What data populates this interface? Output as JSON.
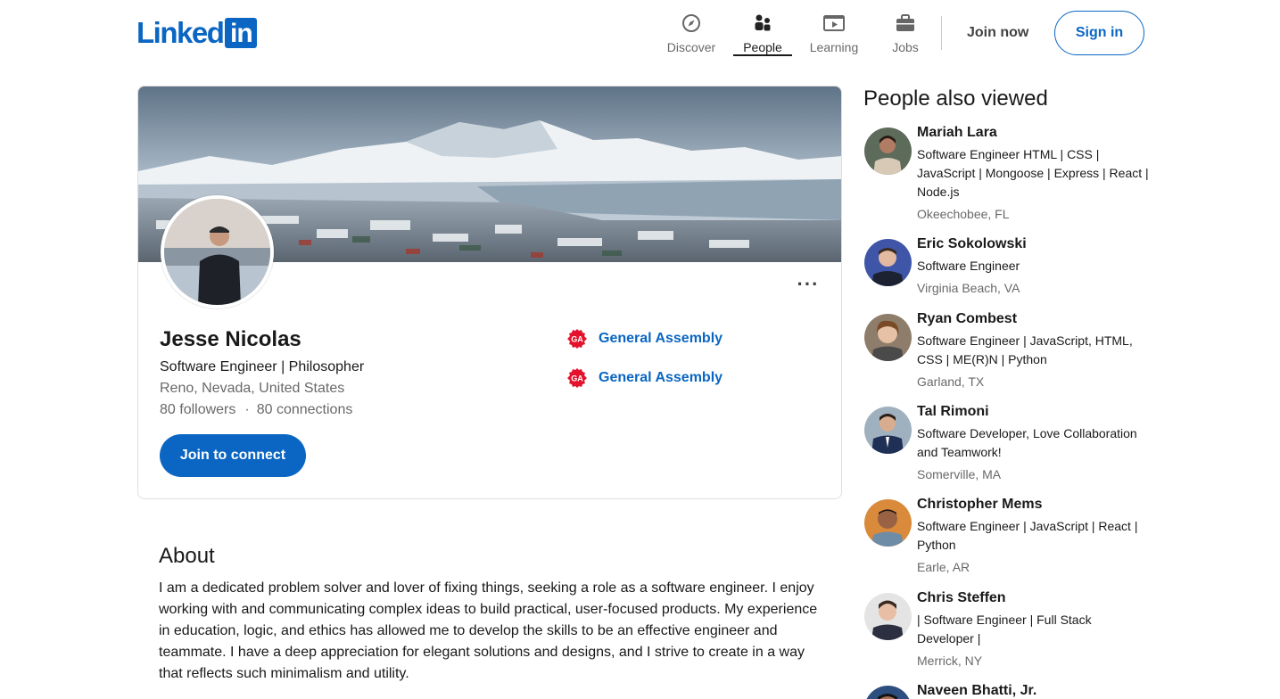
{
  "header": {
    "logo_word": "Linked",
    "logo_box": "in",
    "nav": [
      {
        "label": "Discover",
        "icon": "compass-icon"
      },
      {
        "label": "People",
        "icon": "people-icon"
      },
      {
        "label": "Learning",
        "icon": "play-icon"
      },
      {
        "label": "Jobs",
        "icon": "briefcase-icon"
      }
    ],
    "join_now": "Join now",
    "sign_in": "Sign in"
  },
  "profile": {
    "name": "Jesse Nicolas",
    "headline": "Software Engineer | Philosopher",
    "location": "Reno, Nevada, United States",
    "followers": "80 followers",
    "connections": "80 connections",
    "dot": "·",
    "more": "···",
    "connect_button": "Join to connect",
    "education": [
      {
        "name": "General Assembly",
        "logo": "general-assembly-logo"
      },
      {
        "name": "General Assembly",
        "logo": "general-assembly-logo"
      }
    ]
  },
  "about": {
    "title": "About",
    "text": "I am a dedicated problem solver and lover of fixing things, seeking a role as a software engineer. I enjoy working with and communicating complex ideas to build practical, user-focused products. My experience in education, logic, and ethics has allowed me to develop the skills to be an effective engineer and teammate. I have a deep appreciation for elegant solutions and designs, and I strive to create in a way that reflects such minimalism and utility."
  },
  "sidebar": {
    "title": "People also viewed",
    "people": [
      {
        "name": "Mariah Lara",
        "headline": "Software Engineer HTML | CSS | JavaScript | Mongoose | Express | React | Node.js",
        "location": "Okeechobee, FL"
      },
      {
        "name": "Eric Sokolowski",
        "headline": "Software Engineer",
        "location": "Virginia Beach, VA"
      },
      {
        "name": "Ryan Combest",
        "headline": "Software Engineer | JavaScript, HTML, CSS | ME(R)N | Python",
        "location": "Garland, TX"
      },
      {
        "name": "Tal Rimoni",
        "headline": "Software Developer, Love Collaboration and Teamwork!",
        "location": "Somerville, MA"
      },
      {
        "name": "Christopher Mems",
        "headline": "Software Engineer | JavaScript | React | Python",
        "location": "Earle, AR"
      },
      {
        "name": "Chris Steffen",
        "headline": "| Software Engineer | Full Stack Developer |",
        "location": "Merrick, NY"
      },
      {
        "name": "Naveen Bhatti, Jr.",
        "headline": "",
        "location": ""
      }
    ]
  },
  "colors": {
    "brand": "#0a66c2",
    "ga_red": "#e3122d"
  }
}
